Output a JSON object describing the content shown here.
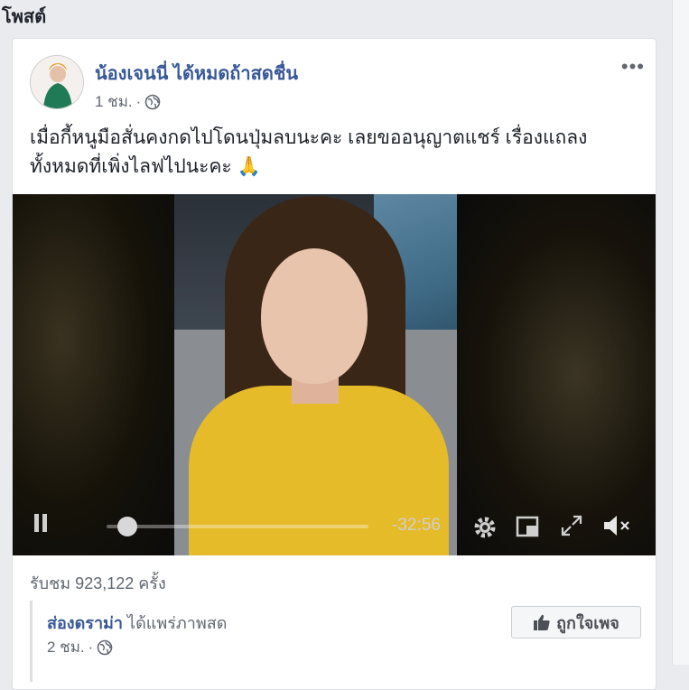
{
  "section": {
    "title": "โพสต์"
  },
  "post": {
    "author": "น้องเจนนี่ ได้หมดถ้าสดชื่น",
    "time": "1 ชม.",
    "separator": "·",
    "more": "•••",
    "text_line1": "เมื่อกี้หนูมือสั่นคงกดไปโดนปุ่มลบนะคะ เลยขออนุญาตแชร์ เรื่องแถลง",
    "text_line2": "ทั้งหมดที่เพิ่งไลฟไปนะคะ 🙏",
    "video": {
      "time_remaining": "-32:56",
      "progress": 0.08
    },
    "views": "รับชม 923,122 ครั้ง"
  },
  "shared": {
    "page_name": "ส่องดราม่า",
    "action": "ได้แพร่ภาพสด",
    "time": "2 ชม.",
    "separator": "·",
    "like_button": "ถูกใจเพจ"
  },
  "icons": {
    "globe": "globe-icon",
    "pause": "pause-icon",
    "settings": "settings-gear-icon",
    "pip": "picture-in-picture-icon",
    "fullscreen": "fullscreen-icon",
    "mute": "volume-muted-icon",
    "like": "thumbs-up-icon"
  },
  "colors": {
    "link": "#385898",
    "secondary_text": "#606770",
    "shirt": "#e6bb2a"
  }
}
